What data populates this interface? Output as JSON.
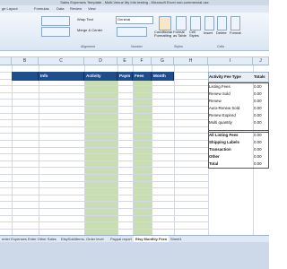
{
  "window": {
    "title": "Sales Expenses Template - Multi-Venue My Info testing - Microsoft Excel non-commercial use"
  },
  "ribbon_tabs": [
    "ge Layout",
    "Formulas",
    "Data",
    "Review",
    "View"
  ],
  "ribbon": {
    "wrap_text": "Wrap Text",
    "merge_center": "Merge & Center",
    "number_format": "General",
    "conditional_formatting": "Conditional Formatting",
    "format_as_table": "Format as Table",
    "cell_styles": "Cell Styles",
    "insert": "Insert",
    "delete": "Delete",
    "format": "Format",
    "groups": [
      "Alignment",
      "Number",
      "Styles",
      "Cells"
    ]
  },
  "columns": [
    "B",
    "C",
    "D",
    "E",
    "F",
    "G",
    "H",
    "I",
    "J"
  ],
  "sheet_headers": {
    "info": "Info",
    "activity": "Activity",
    "payment": "Paym",
    "fees": "Fees",
    "month": "Month"
  },
  "summary_table": {
    "header_label": "Activity Fee Type",
    "header_value": "Totals",
    "rows": [
      {
        "label": "Listing Fees",
        "value": "0.00"
      },
      {
        "label": "Renew Sold",
        "value": "0.00"
      },
      {
        "label": "Renew",
        "value": "0.00"
      },
      {
        "label": "Auto-Renew Sold",
        "value": "0.00"
      },
      {
        "label": "Renew Expired",
        "value": "0.00"
      },
      {
        "label": "Multi quantity",
        "value": "0.00"
      }
    ],
    "totals": [
      {
        "label": "All Listing Fees",
        "value": "0.00"
      },
      {
        "label": "Shipping Labels",
        "value": "0.00"
      },
      {
        "label": "Transaction",
        "value": "0.00"
      },
      {
        "label": "Other",
        "value": "0.00"
      },
      {
        "label": "Total",
        "value": "0.00"
      }
    ]
  },
  "sheet_tabs": [
    "enter Expenses",
    "Enter Other Sales",
    "EtsySoldItems- Order level",
    "Paypal report",
    "Etsy Monthly Fees",
    "Sheet1"
  ],
  "active_tab_index": 4,
  "colors": {
    "header_blue": "#1f4e8c",
    "green_fill": "#c9ddb4"
  }
}
